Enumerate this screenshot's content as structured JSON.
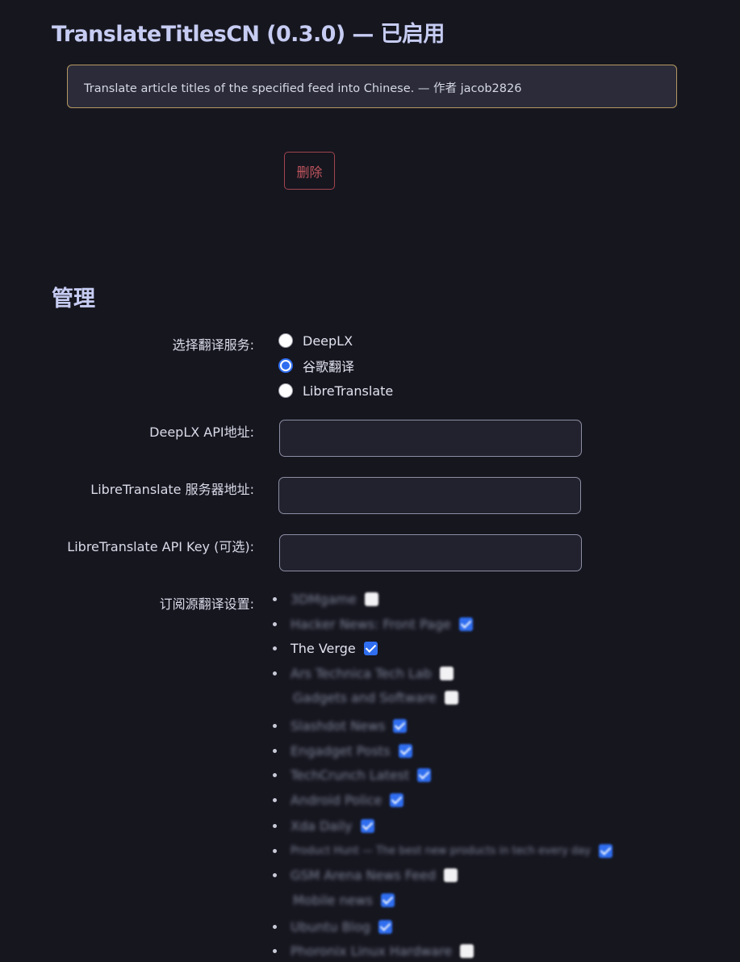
{
  "extension": {
    "title": "TranslateTitlesCN (0.3.0) — 已启用",
    "description": "Translate article titles of the specified feed into Chinese. — 作者 jacob2826",
    "delete_label": "删除"
  },
  "manage": {
    "heading": "管理",
    "service_label": "选择翻译服务:",
    "services": [
      {
        "label": "DeepLX",
        "selected": false
      },
      {
        "label": "谷歌翻译",
        "selected": true
      },
      {
        "label": "LibreTranslate",
        "selected": false
      }
    ],
    "deeplx_label": "DeepLX API地址:",
    "deeplx_value": "",
    "libre_server_label": "LibreTranslate 服务器地址:",
    "libre_server_value": "",
    "libre_key_label": "LibreTranslate API Key (可选):",
    "libre_key_value": "",
    "feeds_label": "订阅源翻译设置:",
    "feeds": [
      {
        "name": "3DMgame",
        "checked": false,
        "blurred": true
      },
      {
        "name": "Hacker News: Front Page",
        "checked": true,
        "blurred": true
      },
      {
        "name": "The Verge",
        "checked": true,
        "blurred": false
      },
      {
        "name": "Ars Technica Tech Lab",
        "checked": false,
        "blurred": true,
        "continuation": "Gadgets and Software"
      },
      {
        "name": "Slashdot News",
        "checked": true,
        "blurred": true
      },
      {
        "name": "Engadget Posts",
        "checked": true,
        "blurred": true
      },
      {
        "name": "TechCrunch Latest",
        "checked": true,
        "blurred": true
      },
      {
        "name": "Android Police",
        "checked": true,
        "blurred": true
      },
      {
        "name": "Xda Daily",
        "checked": true,
        "blurred": true
      },
      {
        "name": "Product Hunt — The best new products in tech every day",
        "checked": true,
        "blurred": true
      },
      {
        "name": "GSM Arena News Feed",
        "checked": false,
        "blurred": true,
        "continuation": "Mobile news",
        "continuation_checked": true
      },
      {
        "name": "Ubuntu Blog",
        "checked": true,
        "blurred": true
      },
      {
        "name": "Phoronix Linux Hardware",
        "checked": false,
        "blurred": true
      }
    ]
  }
}
